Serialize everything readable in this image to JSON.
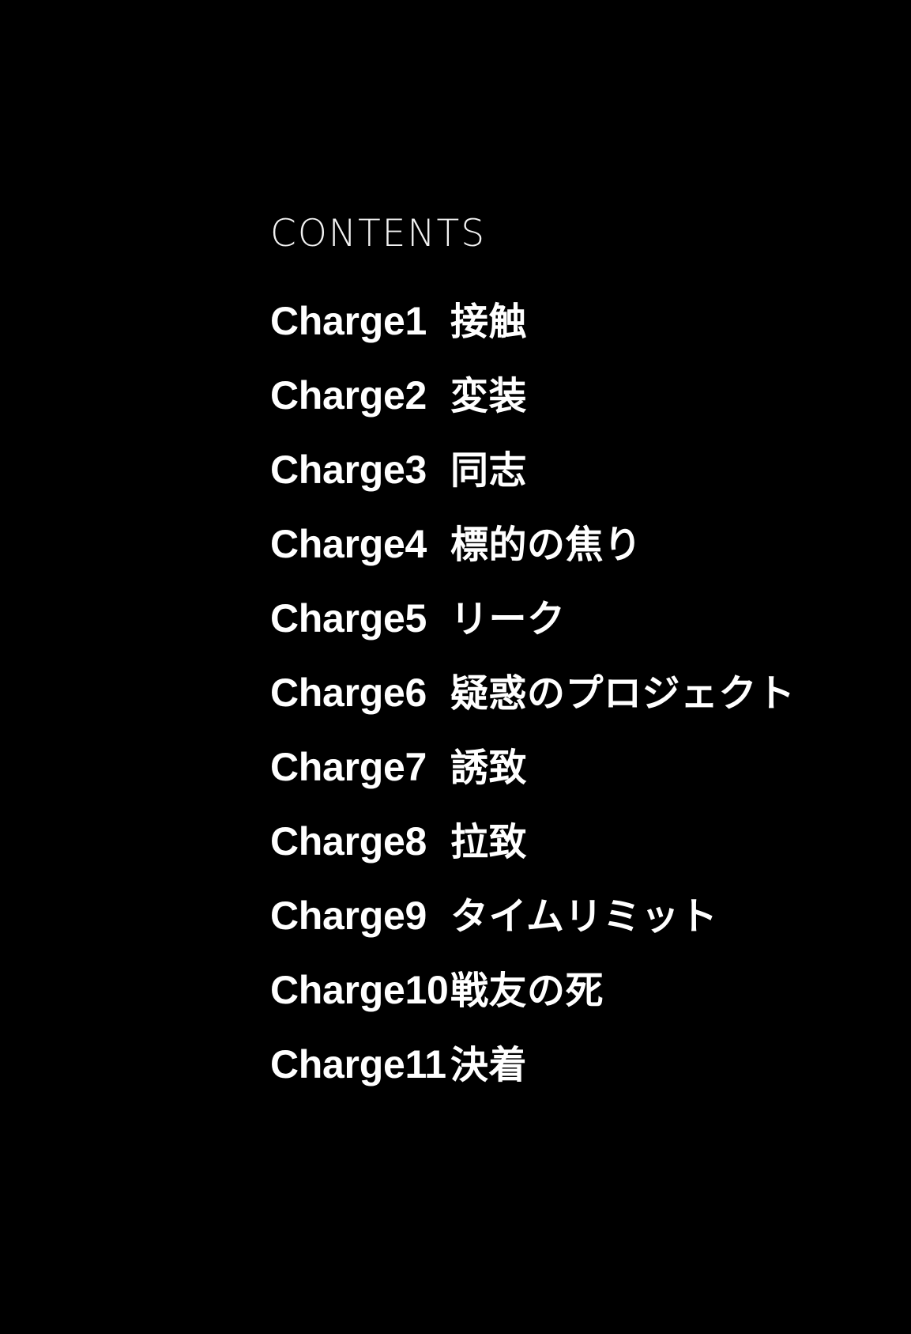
{
  "page": {
    "background_color": "#000000",
    "text_color": "#ffffff"
  },
  "toc": {
    "heading": "CONTENTS",
    "entries": [
      {
        "number": "Charge1",
        "title": "接触"
      },
      {
        "number": "Charge2",
        "title": "変装"
      },
      {
        "number": "Charge3",
        "title": "同志"
      },
      {
        "number": "Charge4",
        "title": "標的の焦り"
      },
      {
        "number": "Charge5",
        "title": "リーク"
      },
      {
        "number": "Charge6",
        "title": "疑惑のプロジェクト"
      },
      {
        "number": "Charge7",
        "title": "誘致"
      },
      {
        "number": "Charge8",
        "title": "拉致"
      },
      {
        "number": "Charge9",
        "title": "タイムリミット"
      },
      {
        "number": "Charge10",
        "title": "戦友の死"
      },
      {
        "number": "Charge11",
        "title": "決着"
      }
    ]
  }
}
